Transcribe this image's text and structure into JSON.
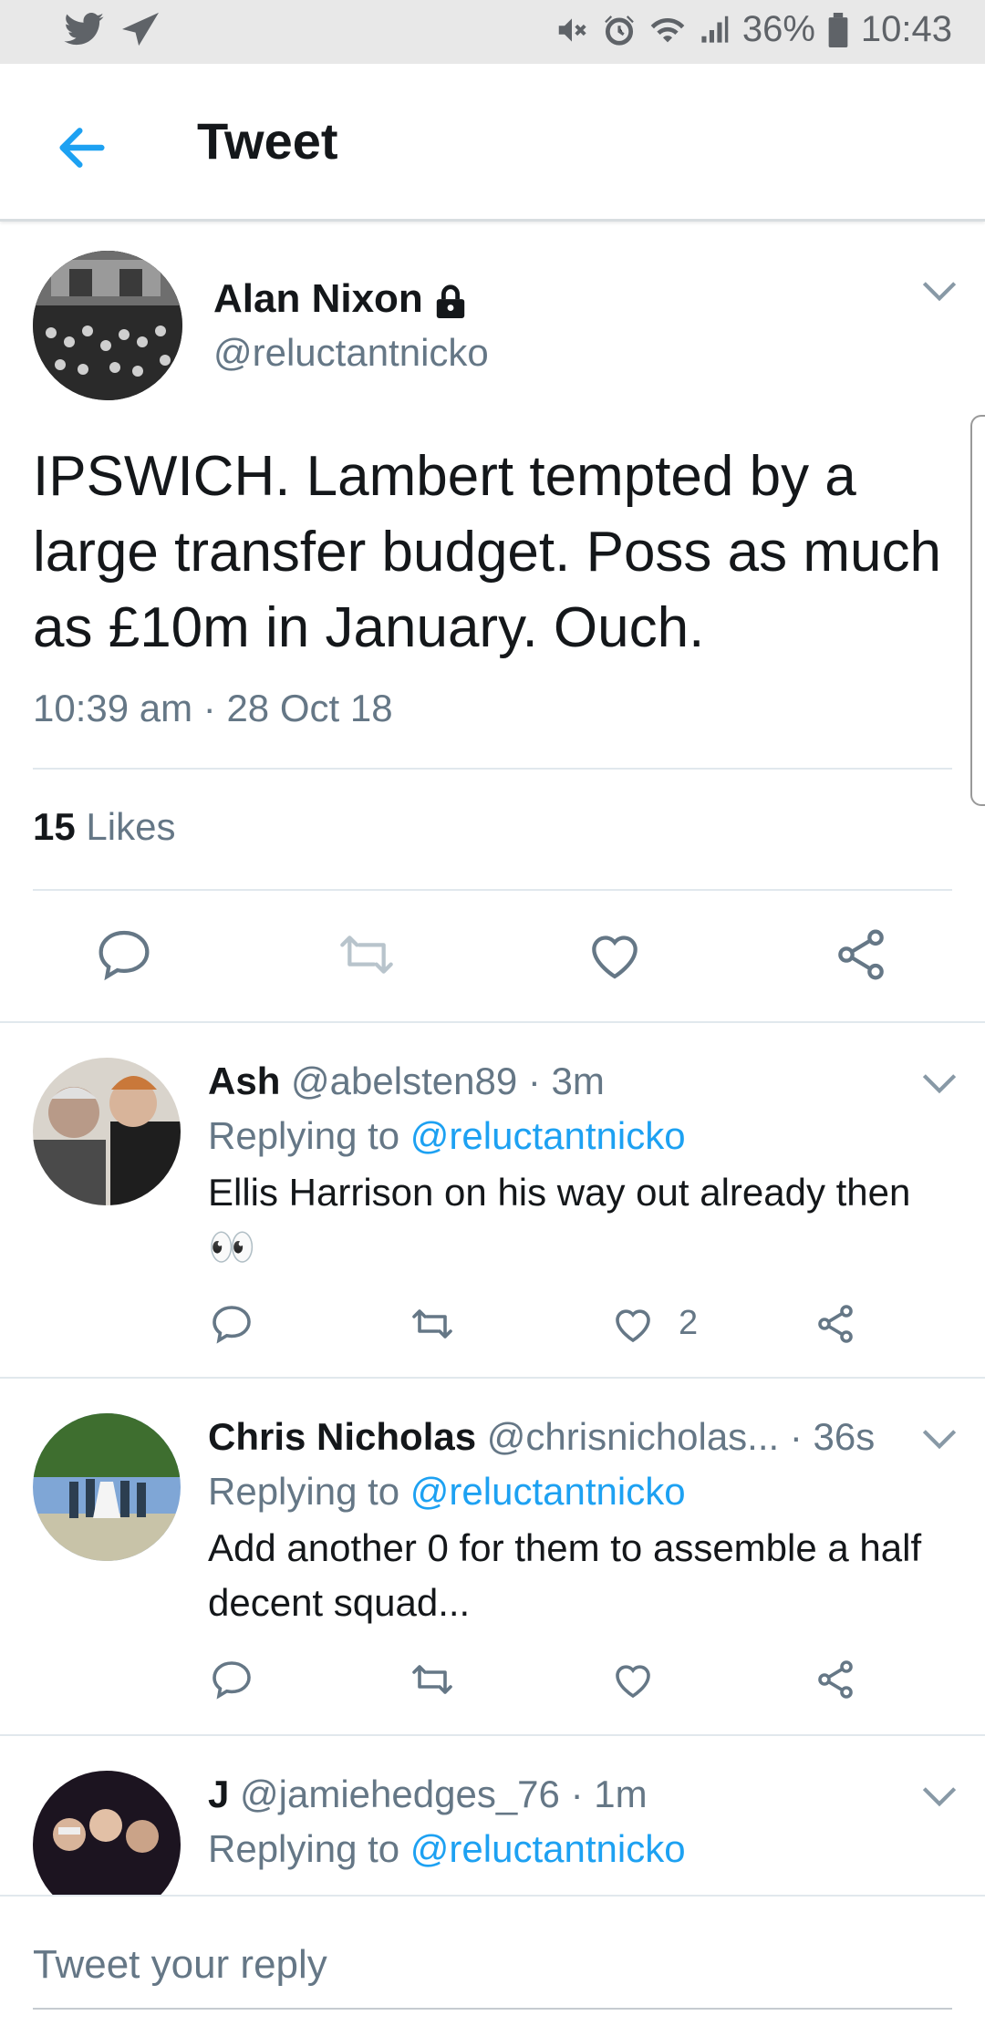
{
  "status_bar": {
    "battery": "36%",
    "time": "10:43"
  },
  "header": {
    "title": "Tweet"
  },
  "main_tweet": {
    "name": "Alan Nixon",
    "handle": "@reluctantnicko",
    "text": "IPSWICH. Lambert tempted by a large transfer budget. Poss as much as £10m in January. Ouch.",
    "timestamp": "10:39 am · 28 Oct 18",
    "likes_count": "15",
    "likes_label": "Likes"
  },
  "replies": [
    {
      "name": "Ash",
      "handle": "@abelsten89",
      "age": "· 3m",
      "replying_prefix": "Replying to",
      "replying_to": "@reluctantnicko",
      "text": "Ellis Harrison on his way out already then 👀",
      "like_count": "2"
    },
    {
      "name": "Chris Nicholas",
      "handle": "@chrisnicholas...",
      "age": "· 36s",
      "replying_prefix": "Replying to",
      "replying_to": "@reluctantnicko",
      "text": "Add another 0 for them to assemble a half decent squad...",
      "like_count": ""
    },
    {
      "name": "J",
      "handle": "@jamiehedges_76",
      "age": "· 1m",
      "replying_prefix": "Replying to",
      "replying_to": "@reluctantnicko",
      "text": "",
      "like_count": ""
    }
  ],
  "composer": {
    "placeholder": "Tweet your reply"
  },
  "colors": {
    "accent": "#1da1f2",
    "secondary_text": "#657786",
    "primary_text": "#14171a"
  }
}
